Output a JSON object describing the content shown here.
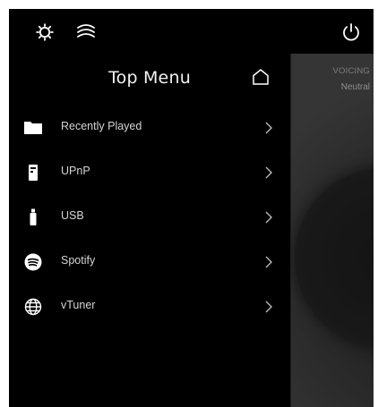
{
  "topbar": {
    "icons": [
      "gear-icon",
      "signal-waves-icon",
      "power-icon"
    ]
  },
  "panel": {
    "title": "Top Menu",
    "home_icon": "home-icon",
    "items": [
      {
        "label": "Recently Played",
        "icon": "folder-icon"
      },
      {
        "label": "UPnP",
        "icon": "media-server-icon"
      },
      {
        "label": "USB",
        "icon": "usb-drive-icon"
      },
      {
        "label": "Spotify",
        "icon": "spotify-icon"
      },
      {
        "label": "vTuner",
        "icon": "globe-icon"
      }
    ]
  },
  "voicing": {
    "label": "VOICING",
    "value": "Neutral"
  },
  "colors": {
    "background": "#000000",
    "text_primary": "#f2f2f2",
    "text_secondary": "#d4d4d4",
    "muted": "#8e8e8e"
  }
}
